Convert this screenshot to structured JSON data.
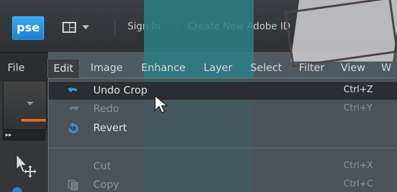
{
  "topbar": {
    "logo_text": "pse",
    "sign_in": "Sign In",
    "create_id": "Create New Adobe ID"
  },
  "menubar": {
    "items": [
      "File",
      "Edit",
      "Image",
      "Enhance",
      "Layer",
      "Select",
      "Filter",
      "View",
      "W"
    ],
    "active": "Edit"
  },
  "edit_menu": {
    "items": [
      {
        "label": "Undo Crop",
        "shortcut": "Ctrl+Z",
        "enabled": true,
        "highlighted": true,
        "icon": "undo-icon"
      },
      {
        "label": "Redo",
        "shortcut": "Ctrl+Y",
        "enabled": false,
        "icon": "redo-icon"
      },
      {
        "label": "Revert",
        "shortcut": "",
        "enabled": true,
        "icon": "revert-icon"
      },
      {
        "label": "Cut",
        "shortcut": "Ctrl+X",
        "enabled": false,
        "icon": ""
      },
      {
        "label": "Copy",
        "shortcut": "Ctrl+C",
        "enabled": false,
        "icon": "copy-icon"
      }
    ]
  },
  "tools": {
    "fast_forward": "▸▸"
  },
  "colors": {
    "accent": "#1a7fd0",
    "foreground_swatch": "#e4681b"
  }
}
